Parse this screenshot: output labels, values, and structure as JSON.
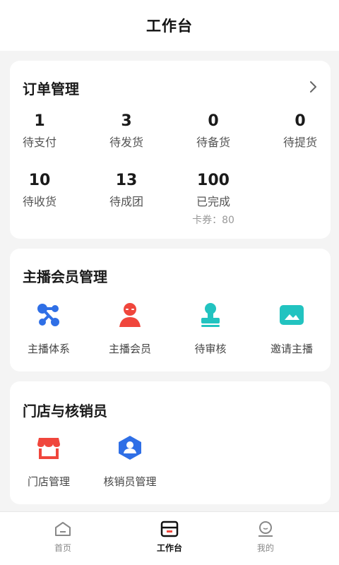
{
  "header": {
    "title": "工作台"
  },
  "orders": {
    "title": "订单管理",
    "stats": [
      {
        "num": "1",
        "label": "待支付"
      },
      {
        "num": "3",
        "label": "待发货"
      },
      {
        "num": "0",
        "label": "待备货"
      },
      {
        "num": "0",
        "label": "待提货"
      },
      {
        "num": "10",
        "label": "待收货"
      },
      {
        "num": "13",
        "label": "待成团"
      },
      {
        "num": "100",
        "label": "已完成",
        "sub": "卡券：80"
      }
    ]
  },
  "host": {
    "title": "主播会员管理",
    "items": [
      {
        "label": "主播体系",
        "icon": "network-icon"
      },
      {
        "label": "主播会员",
        "icon": "user-icon"
      },
      {
        "label": "待审核",
        "icon": "stamp-icon"
      },
      {
        "label": "邀请主播",
        "icon": "image-icon"
      }
    ]
  },
  "store": {
    "title": "门店与核销员",
    "items": [
      {
        "label": "门店管理",
        "icon": "store-icon"
      },
      {
        "label": "核销员管理",
        "icon": "verifier-icon"
      }
    ]
  },
  "tabbar": {
    "tabs": [
      {
        "label": "首页",
        "icon": "home-icon"
      },
      {
        "label": "工作台",
        "icon": "workbench-icon",
        "active": true
      },
      {
        "label": "我的",
        "icon": "profile-icon"
      }
    ]
  },
  "colors": {
    "blue": "#2f6fe6",
    "red": "#f0463c",
    "teal": "#22c3c0",
    "dark": "#1a1a1a"
  }
}
